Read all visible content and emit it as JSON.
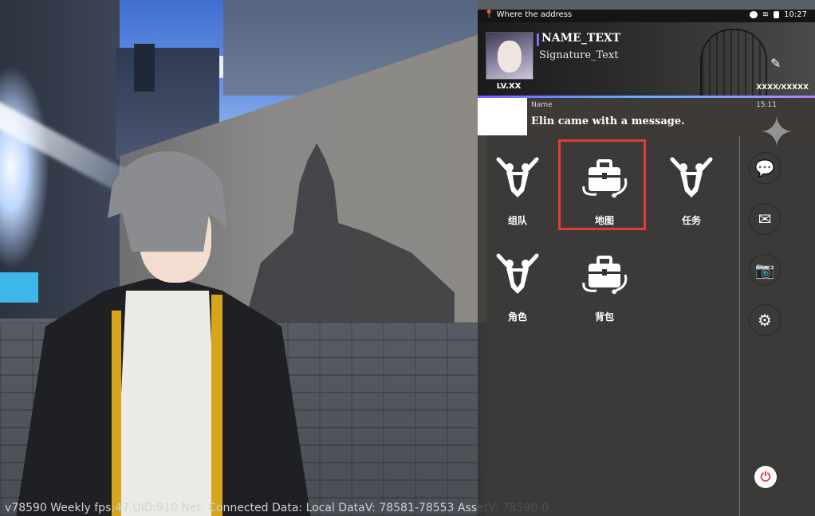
{
  "status_bar": {
    "location": "Where the address",
    "time": "10:27"
  },
  "profile": {
    "name": "NAME_TEXT",
    "signature": "Signature_Text",
    "level": "LV.XX",
    "counter": "XXXX/XXXXX"
  },
  "message": {
    "sender": "Name",
    "time": "15:11",
    "text": "Elin came with a message."
  },
  "menu": {
    "items": [
      {
        "label": "组队",
        "icon": "team-swords-icon"
      },
      {
        "label": "地图",
        "icon": "briefcase-icon"
      },
      {
        "label": "任务",
        "icon": "swords-shield-icon"
      },
      {
        "label": "角色",
        "icon": "swords-shield-icon"
      },
      {
        "label": "背包",
        "icon": "briefcase-icon"
      }
    ],
    "highlighted": "地图"
  },
  "side_buttons": [
    "chat-icon",
    "mail-icon",
    "camera-icon",
    "settings-icon",
    "power-icon"
  ],
  "debug": {
    "text": "v78590  Weekly  fps:47  UID:910  Net: Connected  Data: Local  DataV: 78581-78553 AssetV: 78590-0"
  },
  "colors": {
    "highlight": "#e53935",
    "accent": "#7c5dff",
    "panel": "#343230"
  }
}
